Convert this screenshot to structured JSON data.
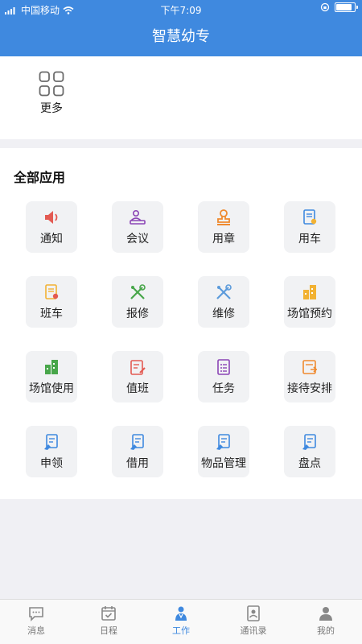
{
  "status_bar": {
    "carrier": "中国移动",
    "time": "下午7:09"
  },
  "header": {
    "title": "智慧幼专"
  },
  "shortcuts": {
    "more_label": "更多"
  },
  "apps": {
    "section_title": "全部应用",
    "items": [
      {
        "label": "通知",
        "icon": "speaker-icon",
        "color": "#e35a52"
      },
      {
        "label": "会议",
        "icon": "meeting-icon",
        "color": "#8b45b5"
      },
      {
        "label": "用章",
        "icon": "stamp-icon",
        "color": "#ef8a2f"
      },
      {
        "label": "用车",
        "icon": "car-doc-icon",
        "color": "#3f89df"
      },
      {
        "label": "班车",
        "icon": "bus-doc-icon",
        "color": "#f2b233"
      },
      {
        "label": "报修",
        "icon": "tools-icon",
        "color": "#48a64a"
      },
      {
        "label": "维修",
        "icon": "repair-tools-icon",
        "color": "#5c9bdb"
      },
      {
        "label": "场馆预约",
        "icon": "building-icon",
        "color": "#f2b233"
      },
      {
        "label": "场馆使用",
        "icon": "building-use-icon",
        "color": "#48a64a"
      },
      {
        "label": "值班",
        "icon": "duty-icon",
        "color": "#e35a52"
      },
      {
        "label": "任务",
        "icon": "task-icon",
        "color": "#8b45b5"
      },
      {
        "label": "接待安排",
        "icon": "reception-icon",
        "color": "#ef8a2f"
      },
      {
        "label": "申领",
        "icon": "apply-icon",
        "color": "#3f89df"
      },
      {
        "label": "借用",
        "icon": "borrow-icon",
        "color": "#3f89df"
      },
      {
        "label": "物品管理",
        "icon": "goods-icon",
        "color": "#3f89df"
      },
      {
        "label": "盘点",
        "icon": "inventory-icon",
        "color": "#3f89df"
      }
    ]
  },
  "tabbar": {
    "active_color": "#3f89df",
    "items": [
      {
        "label": "消息",
        "icon": "message-icon"
      },
      {
        "label": "日程",
        "icon": "calendar-icon"
      },
      {
        "label": "工作",
        "icon": "work-icon"
      },
      {
        "label": "通讯录",
        "icon": "contacts-icon"
      },
      {
        "label": "我的",
        "icon": "profile-icon"
      }
    ]
  }
}
